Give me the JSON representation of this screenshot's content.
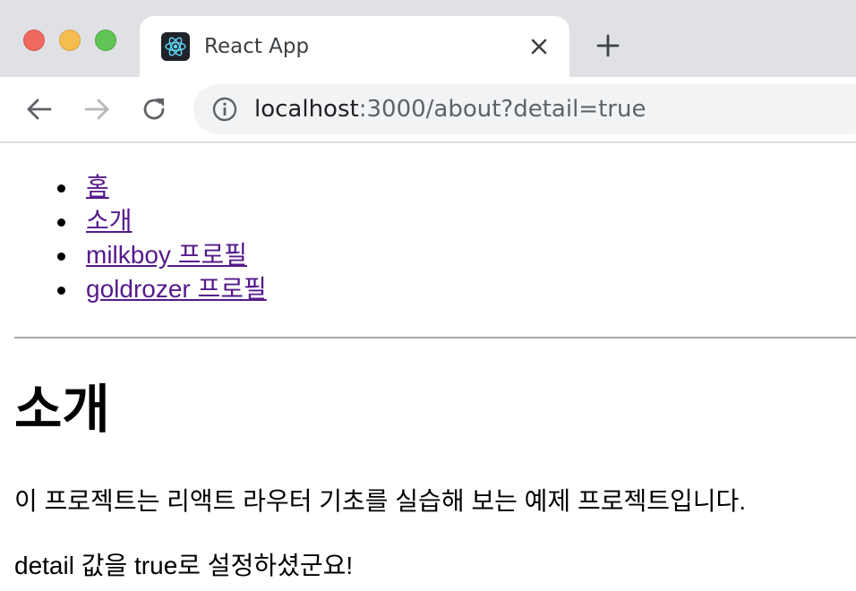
{
  "browser": {
    "tab_title": "React App",
    "favicon": "react-logo-icon",
    "url_host": "localhost",
    "url_rest": ":3000/about?detail=true"
  },
  "nav": {
    "items": [
      {
        "label": "홈"
      },
      {
        "label": "소개"
      },
      {
        "label": "milkboy 프로필"
      },
      {
        "label": "goldrozer 프로필"
      }
    ]
  },
  "main": {
    "title": "소개",
    "description": "이 프로젝트는 리액트 라우터 기초를 실습해 보는 예제 프로젝트입니다.",
    "detail_message": "detail 값을 true로 설정하셨군요!"
  },
  "colors": {
    "link": "#551a8b",
    "titlebar": "#dfe1e5",
    "omnibox": "#f1f3f4"
  }
}
